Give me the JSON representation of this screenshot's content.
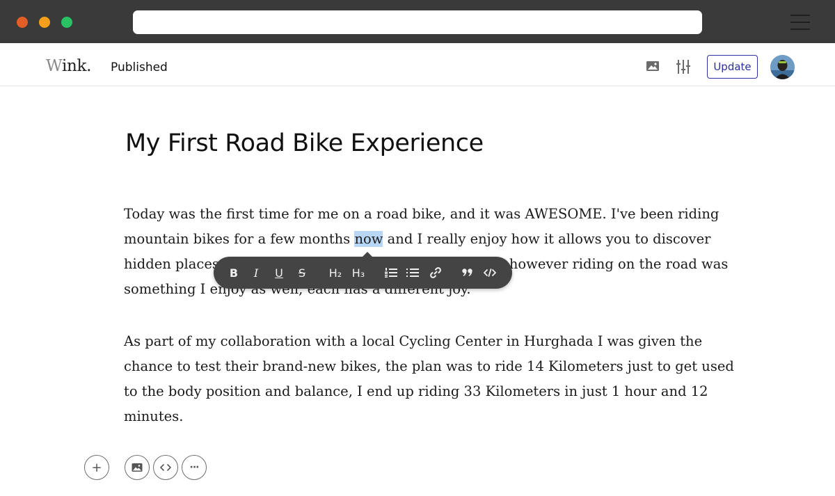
{
  "app": {
    "logo_first": "W",
    "logo_rest": "ink.",
    "status": "Published",
    "update_label": "Update"
  },
  "toolbar": {
    "bold": "B",
    "italic": "I",
    "underline": "U",
    "strike": "S",
    "h2": "H₂",
    "h3": "H₃",
    "icons": [
      "bold-icon",
      "italic-icon",
      "underline-icon",
      "strikethrough-icon",
      "heading-2-icon",
      "heading-3-icon",
      "ordered-list-icon",
      "bullet-list-icon",
      "link-icon",
      "quote-icon",
      "code-icon"
    ]
  },
  "article": {
    "title": "My First Road Bike Experience",
    "para1": {
      "l1": "Today was the first time for me on a road bike, and it was AWESOME. I've been riding",
      "l2a": "mountain bikes for a few months ",
      "l2sel": "now",
      "l2b": " and I really enjoy how it allows you to discover",
      "l3a": "hidden places",
      "l3b": "however riding on the road was",
      "l4": "something I enjoy as well, each has a different joy."
    },
    "para2": {
      "l1": "As part of my collaboration with a local Cycling Center in Hurghada I was given the",
      "l2": "chance to test their brand-new bikes, the plan was to ride 14 Kilometers just to get used",
      "l3": "to the body position and balance, I end up riding 33 Kilometers in just 1 hour and 12",
      "l4": "minutes."
    }
  },
  "insert_bar": {
    "add": "+",
    "more": "···"
  },
  "colors": {
    "chrome": "#3a3a3a",
    "accent": "#2b2f9f",
    "selection": "#b8d7f6",
    "toolbar_bg": "#444444"
  }
}
